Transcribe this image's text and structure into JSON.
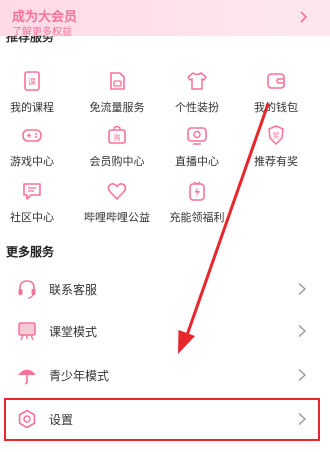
{
  "vip": {
    "title": "成为大会员",
    "subtitle": "了解更多权益"
  },
  "services_section": {
    "title": "推荐服务"
  },
  "grid": [
    {
      "label": "我的课程",
      "icon": "course-icon"
    },
    {
      "label": "免流量服务",
      "icon": "sim-card-icon"
    },
    {
      "label": "个性装扮",
      "icon": "tshirt-icon"
    },
    {
      "label": "我的钱包",
      "icon": "wallet-icon"
    },
    {
      "label": "游戏中心",
      "icon": "gamepad-icon"
    },
    {
      "label": "会员购中心",
      "icon": "shopping-bag-icon"
    },
    {
      "label": "直播中心",
      "icon": "tv-icon"
    },
    {
      "label": "推荐有奖",
      "icon": "reward-badge-icon"
    },
    {
      "label": "社区中心",
      "icon": "community-icon"
    },
    {
      "label": "哔哩哔哩公益",
      "icon": "charity-heart-icon"
    },
    {
      "label": "充能领福利",
      "icon": "charge-gift-icon"
    }
  ],
  "more_services": {
    "title": "更多服务",
    "rows": [
      {
        "label": "联系客服",
        "icon": "headset-icon"
      },
      {
        "label": "课堂模式",
        "icon": "classroom-icon"
      },
      {
        "label": "青少年模式",
        "icon": "umbrella-icon"
      },
      {
        "label": "设置",
        "icon": "settings-gear-icon"
      }
    ]
  },
  "colors": {
    "accent": "#fb7299",
    "highlight": "#e8262b"
  }
}
